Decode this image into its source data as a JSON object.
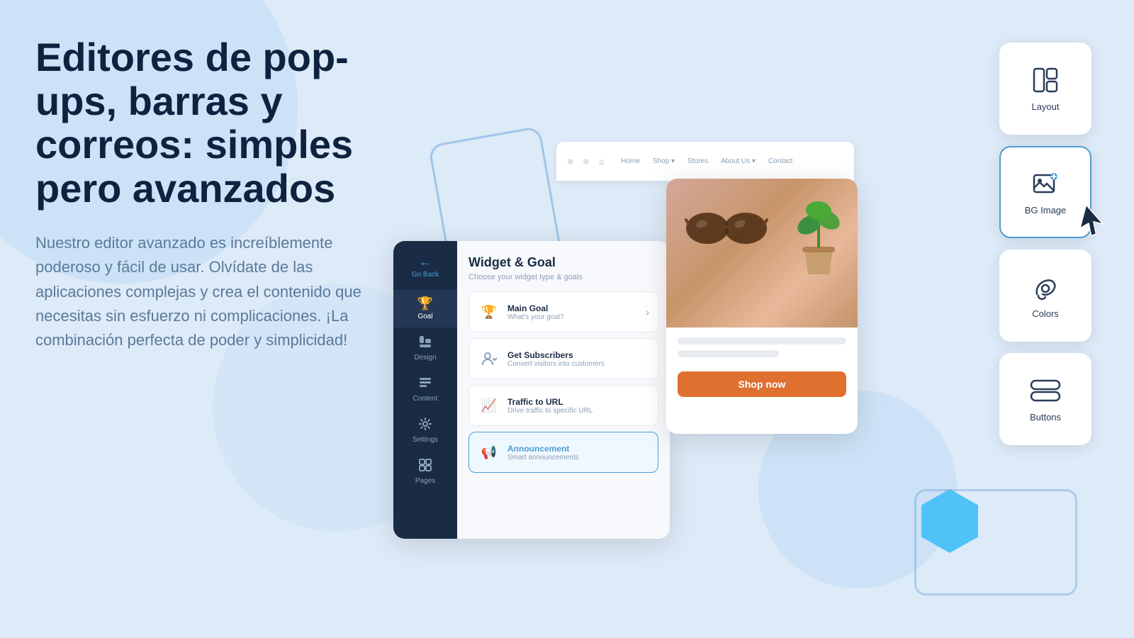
{
  "page": {
    "bg_color": "#ddeaf7"
  },
  "hero": {
    "title": "Editores de pop-ups, barras y correos: simples pero avanzados",
    "subtitle": "Nuestro editor avanzado es increíblemente poderoso y fácil de usar. Olvídate de las aplicaciones complejas y crea el contenido que necesitas sin esfuerzo ni complicaciones. ¡La combinación perfecta de poder y simplicidad!"
  },
  "editor": {
    "title": "Widget & Goal",
    "subtitle": "Choose your widget type & goals",
    "sidebar": {
      "go_back": "Go Back",
      "items": [
        {
          "id": "goal",
          "label": "Goal",
          "icon": "🏆",
          "active": true
        },
        {
          "id": "design",
          "label": "Design",
          "icon": "🖥"
        },
        {
          "id": "content",
          "label": "Content",
          "icon": "📋"
        },
        {
          "id": "settings",
          "label": "Settings",
          "icon": "⚙"
        },
        {
          "id": "pages",
          "label": "Pages",
          "icon": "📄"
        }
      ]
    },
    "goals": [
      {
        "id": "main",
        "icon": "🏆",
        "name": "Main Goal",
        "desc": "What's your goal?",
        "selected": false,
        "blue": false
      },
      {
        "id": "subscribers",
        "icon": "👤",
        "name": "Get Subscribers",
        "desc": "Convert visitors into customers",
        "selected": false,
        "blue": false
      },
      {
        "id": "traffic",
        "icon": "📈",
        "name": "Traffic to URL",
        "desc": "Drive traffic to specific URL",
        "selected": false,
        "blue": false
      },
      {
        "id": "announcement",
        "icon": "📢",
        "name": "Announcement",
        "desc": "Smart announcements",
        "selected": true,
        "blue": true
      }
    ]
  },
  "browser": {
    "nav_items": [
      "Home",
      "Shop ▾",
      "Stores",
      "About Us ▾",
      "Contact"
    ]
  },
  "product": {
    "shop_now_label": "Shop now"
  },
  "right_panel": {
    "cards": [
      {
        "id": "layout",
        "label": "Layout",
        "icon": "layout"
      },
      {
        "id": "bg-image",
        "label": "BG Image",
        "icon": "bg-image",
        "active": true
      },
      {
        "id": "colors",
        "label": "Colors",
        "icon": "colors"
      },
      {
        "id": "buttons",
        "label": "Buttons",
        "icon": "buttons"
      }
    ]
  }
}
